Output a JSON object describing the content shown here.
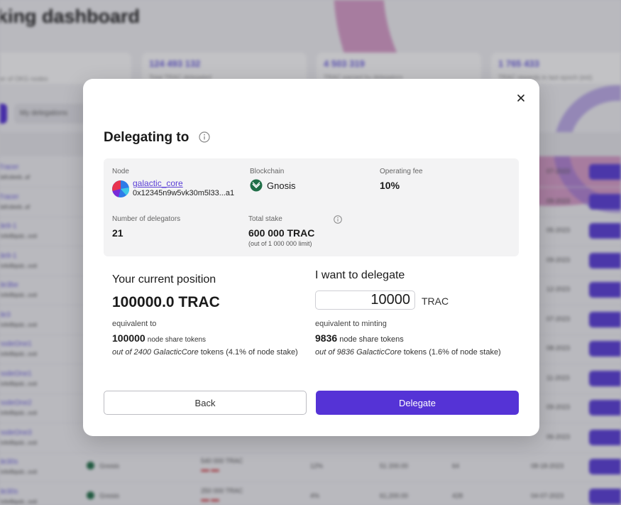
{
  "background": {
    "page_title": "king dashboard",
    "stats": [
      {
        "value": "124 493 132",
        "label": "Total TRAC delegated"
      },
      {
        "value": "4 503 319",
        "label": "TRAC earned by delegators"
      },
      {
        "value": "1 765 433",
        "label": "TRAC rewards in last epoch (est)"
      }
    ],
    "dropdown_label": "er of OKG nodes",
    "tab_label": "My delegations",
    "rows": [
      {
        "name": "Tracer",
        "sub": "dafcdeeb..af"
      },
      {
        "name": "Tracer",
        "sub": "dafcdeeb..af"
      },
      {
        "name": "de9-1",
        "sub": "0xfe8bpdc..ooit"
      },
      {
        "name": "de9-1",
        "sub": "0xfe8bpdc..ooit"
      },
      {
        "name": "de3be",
        "sub": "0xfe8bpdc..ooit"
      },
      {
        "name": "de3",
        "sub": "0xfe8bpdc..ooit"
      },
      {
        "name": "nodeOne1",
        "sub": "0xfe8bpdc..ooit"
      },
      {
        "name": "nodeOne1",
        "sub": "0xfe8bpdc..ooit"
      },
      {
        "name": "nodeOne2",
        "sub": "0xfe8bpdc..ooit"
      },
      {
        "name": "nodeOne3",
        "sub": "0xfe8bpdc..ooit"
      },
      {
        "name": "de30s",
        "sub": "0xfe8bpdc..ooit",
        "chain": "Gnosis",
        "stake": "540 000 TRAC",
        "fee": "12%",
        "earn": "51 200.00",
        "num": "64",
        "date": "08-18-2023"
      },
      {
        "name": "de30s",
        "sub": "0xfe8bpdc..ooit",
        "chain": "Gnosis",
        "stake": "250 000 TRAC",
        "fee": "4%",
        "earn": "61,200.00",
        "num": "428",
        "date": "04-07-2023"
      }
    ],
    "dates": [
      "07-2023",
      "09-2023",
      "05-2023",
      "09-2023",
      "12-2023",
      "07-2023",
      "08-2023",
      "11-2023",
      "09-2023",
      "06-2023"
    ],
    "row_button_label": "Delegate",
    "colors": {
      "accent": "#5533d6",
      "arc": "#c45aa8"
    }
  },
  "modal": {
    "title": "Delegating to",
    "node": {
      "label": "Node",
      "name": "galactic_core",
      "address": "0x12345n9w5vk30m5l33...a1"
    },
    "blockchain": {
      "label": "Blockchain",
      "name": "Gnosis"
    },
    "operating_fee": {
      "label": "Operating fee",
      "value": "10%"
    },
    "delegators": {
      "label": "Number of delegators",
      "value": "21"
    },
    "total_stake": {
      "label": "Total stake",
      "value": "600 000 TRAC",
      "limit": "(out of 1 000 000 limit)"
    },
    "current_position": {
      "heading": "Your current position",
      "value": "100000.0 TRAC",
      "equiv_label": "equivalent  to",
      "tokens_value": "100000",
      "tokens_label": "node share tokens",
      "outof_prefix": "out of 2400 GalacticCore",
      "outof_suffix": "tokens (4.1% of node stake)"
    },
    "delegate": {
      "heading": "I want to delegate",
      "amount": "10000",
      "unit": "TRAC",
      "equiv_label": "equivalent to minting",
      "tokens_value": "9836",
      "tokens_label": "node share tokens",
      "outof_prefix": "out of 9836 GalacticCore",
      "outof_suffix": "tokens (1.6% of node stake)"
    },
    "back_label": "Back",
    "delegate_label": "Delegate",
    "colors": {
      "primary": "#5533d6",
      "link": "#5a3fd6",
      "panel": "#f3f3f4"
    }
  }
}
